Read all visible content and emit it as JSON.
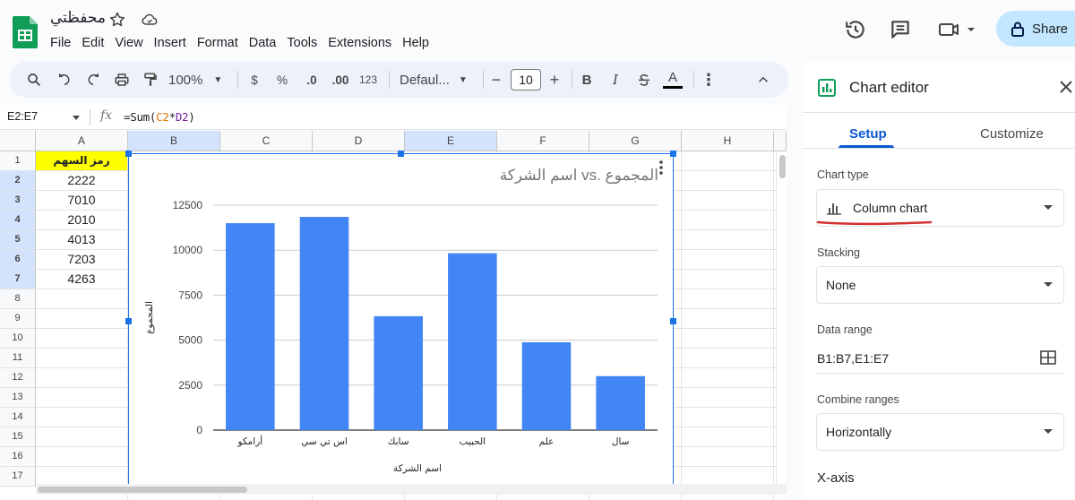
{
  "header": {
    "doc_title": "محفظتي",
    "menu": [
      "File",
      "Edit",
      "View",
      "Insert",
      "Format",
      "Data",
      "Tools",
      "Extensions",
      "Help"
    ],
    "share_label": "Share"
  },
  "toolbar": {
    "zoom": "100%",
    "currency": "$",
    "percent": "%",
    "dec_decrease": ".0",
    "dec_increase": ".00",
    "number_format": "123",
    "font": "Defaul...",
    "font_size": "10",
    "bold": "B",
    "italic": "I",
    "text_color": "A"
  },
  "formula_bar": {
    "name_box": "E2:E7",
    "fx": "fx",
    "formula_prefix": "=Sum(",
    "ref_c": "C2",
    "op": "*",
    "ref_d": "D2",
    "formula_suffix": ")"
  },
  "grid": {
    "columns": [
      "A",
      "B",
      "C",
      "D",
      "E",
      "F",
      "G",
      "H"
    ],
    "rows": [
      "1",
      "2",
      "3",
      "4",
      "5",
      "6",
      "7",
      "8",
      "9",
      "10",
      "11",
      "12",
      "13",
      "14",
      "15",
      "16",
      "17"
    ],
    "col_a": [
      "رمز السهم",
      "2222",
      "7010",
      "2010",
      "4013",
      "7203",
      "4263"
    ]
  },
  "chart_data": {
    "type": "bar",
    "title": "اسم الشركة vs. المجموع",
    "xlabel": "اسم الشركة",
    "ylabel": "المجموع",
    "categories": [
      "أرامكو",
      "اس تي سي",
      "سابك",
      "الحبيب",
      "علم",
      "سال"
    ],
    "values": [
      11500,
      11850,
      6330,
      9830,
      4880,
      3000
    ],
    "yticks": [
      "0",
      "2500",
      "5000",
      "7500",
      "10000",
      "12500"
    ],
    "ylim": [
      0,
      12500
    ],
    "grid": true,
    "color": "#4285f4"
  },
  "editor": {
    "title": "Chart editor",
    "tab_setup": "Setup",
    "tab_customize": "Customize",
    "chart_type_label": "Chart type",
    "chart_type_value": "Column chart",
    "stacking_label": "Stacking",
    "stacking_value": "None",
    "data_range_label": "Data range",
    "data_range_value": "B1:B7,E1:E7",
    "combine_label": "Combine ranges",
    "combine_value": "Horizontally",
    "xaxis_label": "X-axis"
  },
  "colors": {
    "accent": "#0b57d0",
    "header_cell": "#ffff00",
    "selection": "#d3e3fd",
    "annotation": "#d32f2f"
  }
}
